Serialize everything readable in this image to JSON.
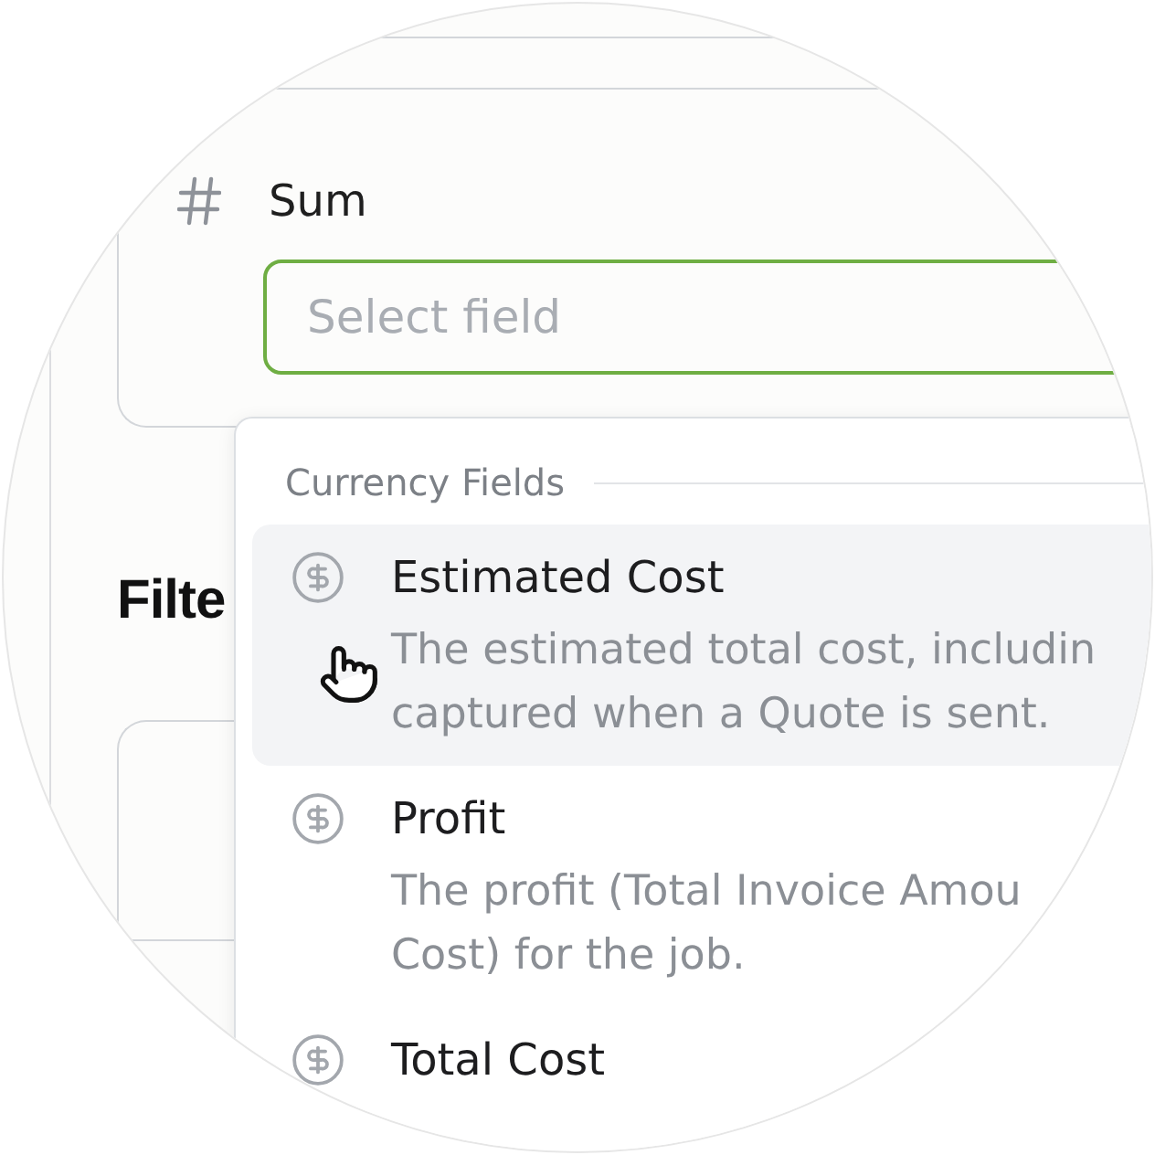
{
  "aggregate": {
    "label": "Sum",
    "select_field": {
      "placeholder": "Select field",
      "focused": true
    }
  },
  "section_heading": "Filte",
  "dropdown": {
    "group_label": "Currency Fields",
    "options": [
      {
        "title": "Estimated Cost",
        "description_lines": [
          "The estimated total cost, includin",
          "captured when a Quote is sent."
        ],
        "highlighted": true
      },
      {
        "title": "Profit",
        "description_lines": [
          "The profit (Total Invoice Amou",
          "Cost) for the job."
        ],
        "highlighted": false
      },
      {
        "title": "Total Cost",
        "highlighted": false
      }
    ]
  }
}
